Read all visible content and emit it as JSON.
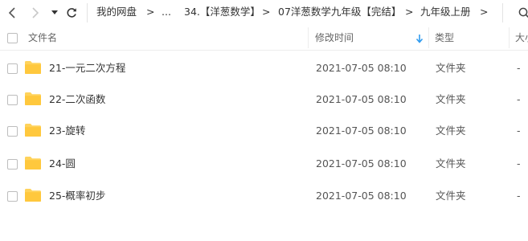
{
  "nav": {
    "breadcrumbs": [
      {
        "label": "我的网盘"
      },
      {
        "label": "..."
      },
      {
        "label": "34.【洋葱数学】"
      },
      {
        "label": "07洋葱数学九年级【完结】"
      },
      {
        "label": "九年级上册"
      }
    ],
    "separator": ">"
  },
  "header": {
    "name": "文件名",
    "modified": "修改时间",
    "type": "类型",
    "size": "大小"
  },
  "files": [
    {
      "name": "21-一元二次方程",
      "modified": "2021-07-05 08:10",
      "type": "文件夹",
      "size": "-"
    },
    {
      "name": "22-二次函数",
      "modified": "2021-07-05 08:10",
      "type": "文件夹",
      "size": "-"
    },
    {
      "name": "23-旋转",
      "modified": "2021-07-05 08:10",
      "type": "文件夹",
      "size": "-"
    },
    {
      "name": "24-圆",
      "modified": "2021-07-05 08:10",
      "type": "文件夹",
      "size": "-"
    },
    {
      "name": "25-概率初步",
      "modified": "2021-07-05 08:10",
      "type": "文件夹",
      "size": "-"
    }
  ],
  "icons": {
    "folder": "folder-icon",
    "back": "chevron-left-icon",
    "forward": "chevron-right-icon",
    "dropdown": "caret-down-icon",
    "refresh": "refresh-icon",
    "sort": "sort-down-arrow-icon"
  },
  "colors": {
    "folder": "#ffd35c",
    "sort_arrow": "#2f9bef",
    "disabled": "#c8c8c8"
  }
}
